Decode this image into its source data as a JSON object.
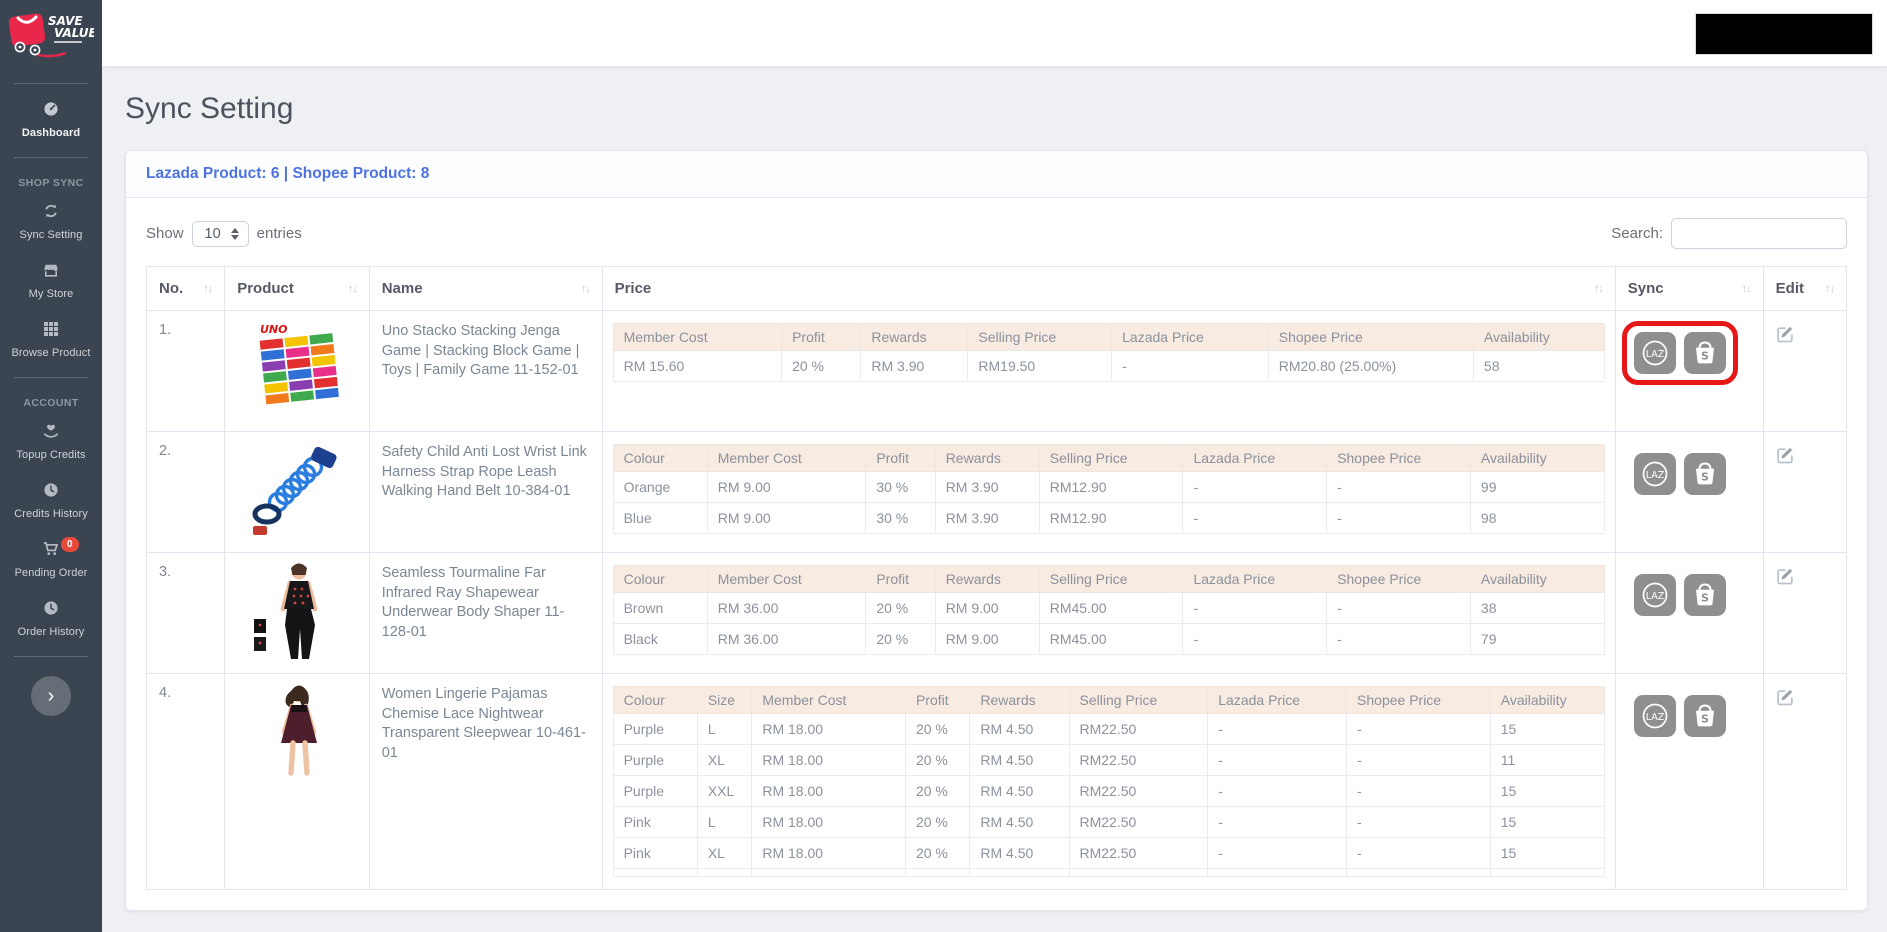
{
  "page": {
    "title": "Sync Setting"
  },
  "sidebar": {
    "brand": {
      "line1": "SAVE",
      "line2": "VALUE"
    },
    "nav": [
      {
        "type": "item",
        "label": "Dashboard",
        "icon": "dashboard-icon",
        "emphasis": true
      },
      {
        "type": "divider"
      },
      {
        "type": "section",
        "label": "SHOP SYNC"
      },
      {
        "type": "item",
        "label": "Sync Setting",
        "icon": "sync-icon"
      },
      {
        "type": "item",
        "label": "My Store",
        "icon": "store-icon"
      },
      {
        "type": "item",
        "label": "Browse Product",
        "icon": "grid-icon"
      },
      {
        "type": "divider"
      },
      {
        "type": "section",
        "label": "ACCOUNT"
      },
      {
        "type": "item",
        "label": "Topup Credits",
        "icon": "hand-heart-icon"
      },
      {
        "type": "item",
        "label": "Credits History",
        "icon": "clock-icon"
      },
      {
        "type": "item",
        "label": "Pending Order",
        "icon": "cart-icon",
        "badge": "0"
      },
      {
        "type": "item",
        "label": "Order History",
        "icon": "clock-icon"
      },
      {
        "type": "divider"
      }
    ],
    "collapse_chevron": "›"
  },
  "card": {
    "header": "Lazada Product: 6 | Shopee Product: 8"
  },
  "table_controls": {
    "show_label": "Show",
    "page_length": "10",
    "entries_label": "entries",
    "search_label": "Search:",
    "search_value": ""
  },
  "table": {
    "sort_glyph": "↑↓",
    "columns": [
      "No.",
      "Product",
      "Name",
      "Price",
      "Sync",
      "Edit"
    ],
    "sync_buttons": {
      "lazada_label": "LAZ",
      "shopee_label": "S"
    },
    "rows": [
      {
        "no": "1.",
        "product_image": "uno-stacko-product",
        "name": "Uno Stacko Stacking Jenga Game | Stacking Block Game | Toys | Family Game 11-152-01",
        "sync_highlighted": true,
        "price_table": {
          "columns": [
            "Member Cost",
            "Profit",
            "Rewards",
            "Selling Price",
            "Lazada Price",
            "Shopee Price",
            "Availability"
          ],
          "rows": [
            [
              "RM 15.60",
              "20 %",
              "RM 3.90",
              "RM19.50",
              "-",
              "RM20.80 (25.00%)",
              "58"
            ]
          ],
          "partial_next_row": false
        }
      },
      {
        "no": "2.",
        "product_image": "wrist-link-product",
        "name": "Safety Child Anti Lost Wrist Link Harness Strap Rope Leash Walking Hand Belt 10-384-01",
        "sync_highlighted": false,
        "price_table": {
          "columns": [
            "Colour",
            "Member Cost",
            "Profit",
            "Rewards",
            "Selling Price",
            "Lazada Price",
            "Shopee Price",
            "Availability"
          ],
          "rows": [
            [
              "Orange",
              "RM 9.00",
              "30 %",
              "RM 3.90",
              "RM12.90",
              "-",
              "-",
              "99"
            ],
            [
              "Blue",
              "RM 9.00",
              "30 %",
              "RM 3.90",
              "RM12.90",
              "-",
              "-",
              "98"
            ]
          ],
          "partial_next_row": false
        }
      },
      {
        "no": "3.",
        "product_image": "shapewear-product",
        "name": "Seamless Tourmaline Far Infrared Ray Shapewear Underwear Body Shaper 11-128-01",
        "sync_highlighted": false,
        "price_table": {
          "columns": [
            "Colour",
            "Member Cost",
            "Profit",
            "Rewards",
            "Selling Price",
            "Lazada Price",
            "Shopee Price",
            "Availability"
          ],
          "rows": [
            [
              "Brown",
              "RM 36.00",
              "20 %",
              "RM 9.00",
              "RM45.00",
              "-",
              "-",
              "38"
            ],
            [
              "Black",
              "RM 36.00",
              "20 %",
              "RM 9.00",
              "RM45.00",
              "-",
              "-",
              "79"
            ]
          ],
          "partial_next_row": false
        }
      },
      {
        "no": "4.",
        "product_image": "nightwear-product",
        "name": "Women Lingerie Pajamas Chemise Lace Nightwear Transparent Sleepwear 10-461-01",
        "sync_highlighted": false,
        "price_table": {
          "columns": [
            "Colour",
            "Size",
            "Member Cost",
            "Profit",
            "Rewards",
            "Selling Price",
            "Lazada Price",
            "Shopee Price",
            "Availability"
          ],
          "rows": [
            [
              "Purple",
              "L",
              "RM 18.00",
              "20 %",
              "RM 4.50",
              "RM22.50",
              "-",
              "-",
              "15"
            ],
            [
              "Purple",
              "XL",
              "RM 18.00",
              "20 %",
              "RM 4.50",
              "RM22.50",
              "-",
              "-",
              "11"
            ],
            [
              "Purple",
              "XXL",
              "RM 18.00",
              "20 %",
              "RM 4.50",
              "RM22.50",
              "-",
              "-",
              "15"
            ],
            [
              "Pink",
              "L",
              "RM 18.00",
              "20 %",
              "RM 4.50",
              "RM22.50",
              "-",
              "-",
              "15"
            ],
            [
              "Pink",
              "XL",
              "RM 18.00",
              "20 %",
              "RM 4.50",
              "RM22.50",
              "-",
              "-",
              "15"
            ]
          ],
          "partial_next_row": true
        }
      }
    ]
  },
  "colors": {
    "accent_blue": "#4e73df",
    "sidebar_bg": "#3a4551",
    "badge_red": "#e74a3b",
    "annotation_red": "#e51717",
    "subtable_header_bg": "#f8ebe2",
    "brand_red": "#e8274b",
    "sync_button_gray": "#8f8f8f"
  }
}
